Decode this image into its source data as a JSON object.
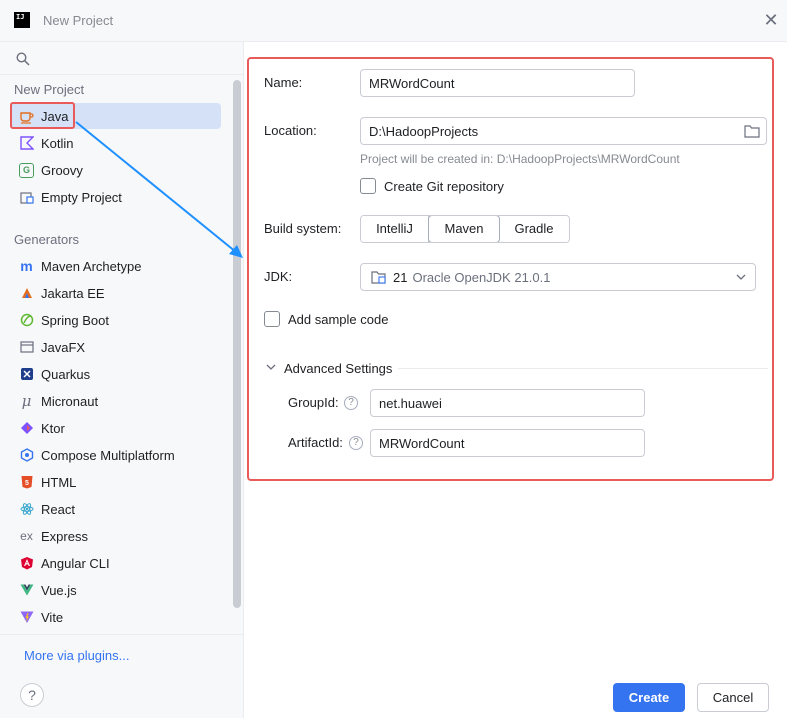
{
  "window": {
    "title": "New Project",
    "logo": "IJ",
    "close_glyph": "✕"
  },
  "sidebar": {
    "search_placeholder": "",
    "new_project_header": "New Project",
    "new_project_items": [
      {
        "label": "Java",
        "icon": "java-cup-icon",
        "selected": true
      },
      {
        "label": "Kotlin",
        "icon": "kotlin-icon"
      },
      {
        "label": "Groovy",
        "icon": "groovy-icon"
      },
      {
        "label": "Empty Project",
        "icon": "empty-project-icon"
      }
    ],
    "generators_header": "Generators",
    "generator_items": [
      {
        "label": "Maven Archetype",
        "icon": "maven-icon"
      },
      {
        "label": "Jakarta EE",
        "icon": "jakarta-ee-icon"
      },
      {
        "label": "Spring Boot",
        "icon": "spring-boot-icon"
      },
      {
        "label": "JavaFX",
        "icon": "javafx-icon"
      },
      {
        "label": "Quarkus",
        "icon": "quarkus-icon"
      },
      {
        "label": "Micronaut",
        "icon": "micronaut-icon"
      },
      {
        "label": "Ktor",
        "icon": "ktor-icon"
      },
      {
        "label": "Compose Multiplatform",
        "icon": "compose-icon"
      },
      {
        "label": "HTML",
        "icon": "html5-icon"
      },
      {
        "label": "React",
        "icon": "react-icon"
      },
      {
        "label": "Express",
        "icon": "express-icon"
      },
      {
        "label": "Angular CLI",
        "icon": "angular-icon"
      },
      {
        "label": "Vue.js",
        "icon": "vue-icon"
      },
      {
        "label": "Vite",
        "icon": "vite-icon"
      }
    ],
    "more_plugins": "More via plugins...",
    "help_glyph": "?"
  },
  "form": {
    "name_label": "Name:",
    "name_value": "MRWordCount",
    "location_label": "Location:",
    "location_value": "D:\\HadoopProjects",
    "location_hint": "Project will be created in: D:\\HadoopProjects\\MRWordCount",
    "git_label": "Create Git repository",
    "build_label": "Build system:",
    "build_options": [
      "IntelliJ",
      "Maven",
      "Gradle"
    ],
    "build_selected": "Maven",
    "jdk_label": "JDK:",
    "jdk_version": "21",
    "jdk_name": "Oracle OpenJDK 21.0.1",
    "sample_label": "Add sample code",
    "advanced_label": "Advanced Settings",
    "groupid_label": "GroupId:",
    "groupid_value": "net.huawei",
    "artifactid_label": "ArtifactId:",
    "artifactid_value": "MRWordCount"
  },
  "footer": {
    "create_label": "Create",
    "cancel_label": "Cancel"
  },
  "colors": {
    "accent": "#3574f0",
    "highlight_red": "#e95b5b",
    "arrow_blue": "#1e90ff",
    "selection": "#d5e1f7"
  }
}
